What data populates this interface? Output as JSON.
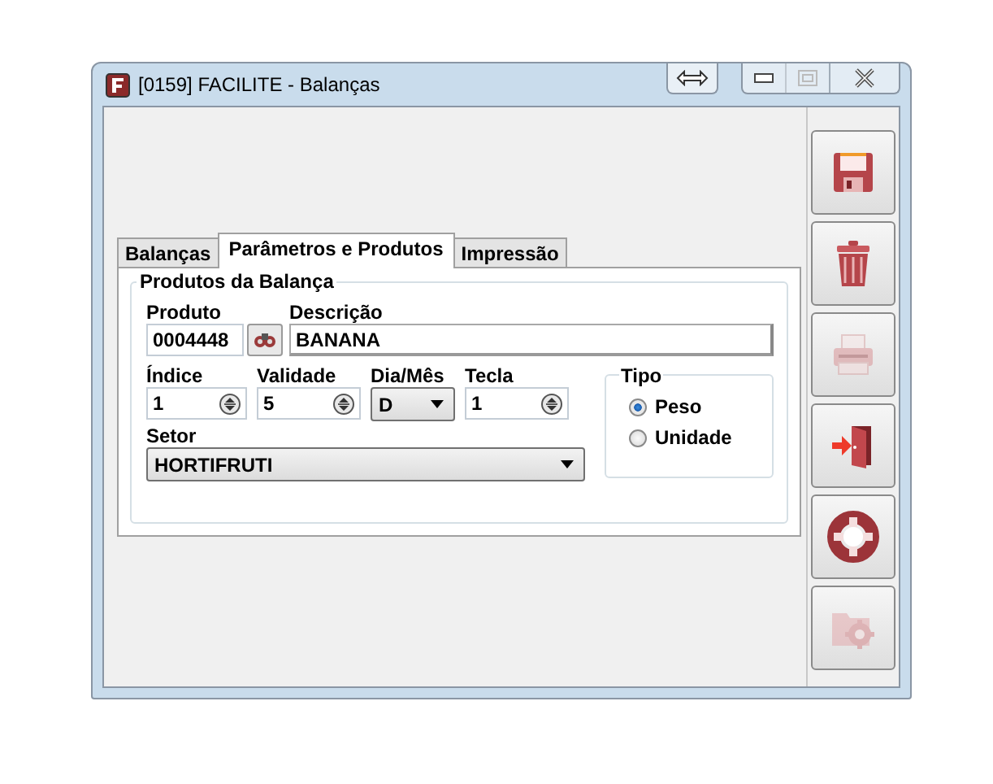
{
  "window": {
    "title": "[0159] FACILITE - Balanças"
  },
  "tabs": [
    {
      "label": "Balanças",
      "selected": false
    },
    {
      "label": "Parâmetros e Produtos",
      "selected": true
    },
    {
      "label": "Impressão",
      "selected": false
    }
  ],
  "group": {
    "title": "Produtos da Balança"
  },
  "produto": {
    "label": "Produto",
    "value": "0004448"
  },
  "descricao": {
    "label": "Descrição",
    "value": "BANANA"
  },
  "spinners": [
    {
      "kind": "spin",
      "label": "Índice",
      "value": "1"
    },
    {
      "kind": "spin",
      "label": "Validade",
      "value": "5"
    },
    {
      "kind": "combo",
      "label": "Dia/Mês",
      "value": "D"
    },
    {
      "kind": "spin",
      "label": "Tecla",
      "value": "1"
    }
  ],
  "setor": {
    "label": "Setor",
    "value": "HORTIFRUTI"
  },
  "tipo": {
    "title": "Tipo",
    "options": [
      {
        "label": "Peso",
        "selected": true
      },
      {
        "label": "Unidade",
        "selected": false
      }
    ]
  },
  "toolbar": [
    {
      "kind": "save",
      "disabled": false
    },
    {
      "kind": "delete",
      "disabled": false
    },
    {
      "kind": "print",
      "disabled": true
    },
    {
      "kind": "exit",
      "disabled": false
    },
    {
      "kind": "help",
      "disabled": false
    },
    {
      "kind": "settings",
      "disabled": true
    }
  ]
}
